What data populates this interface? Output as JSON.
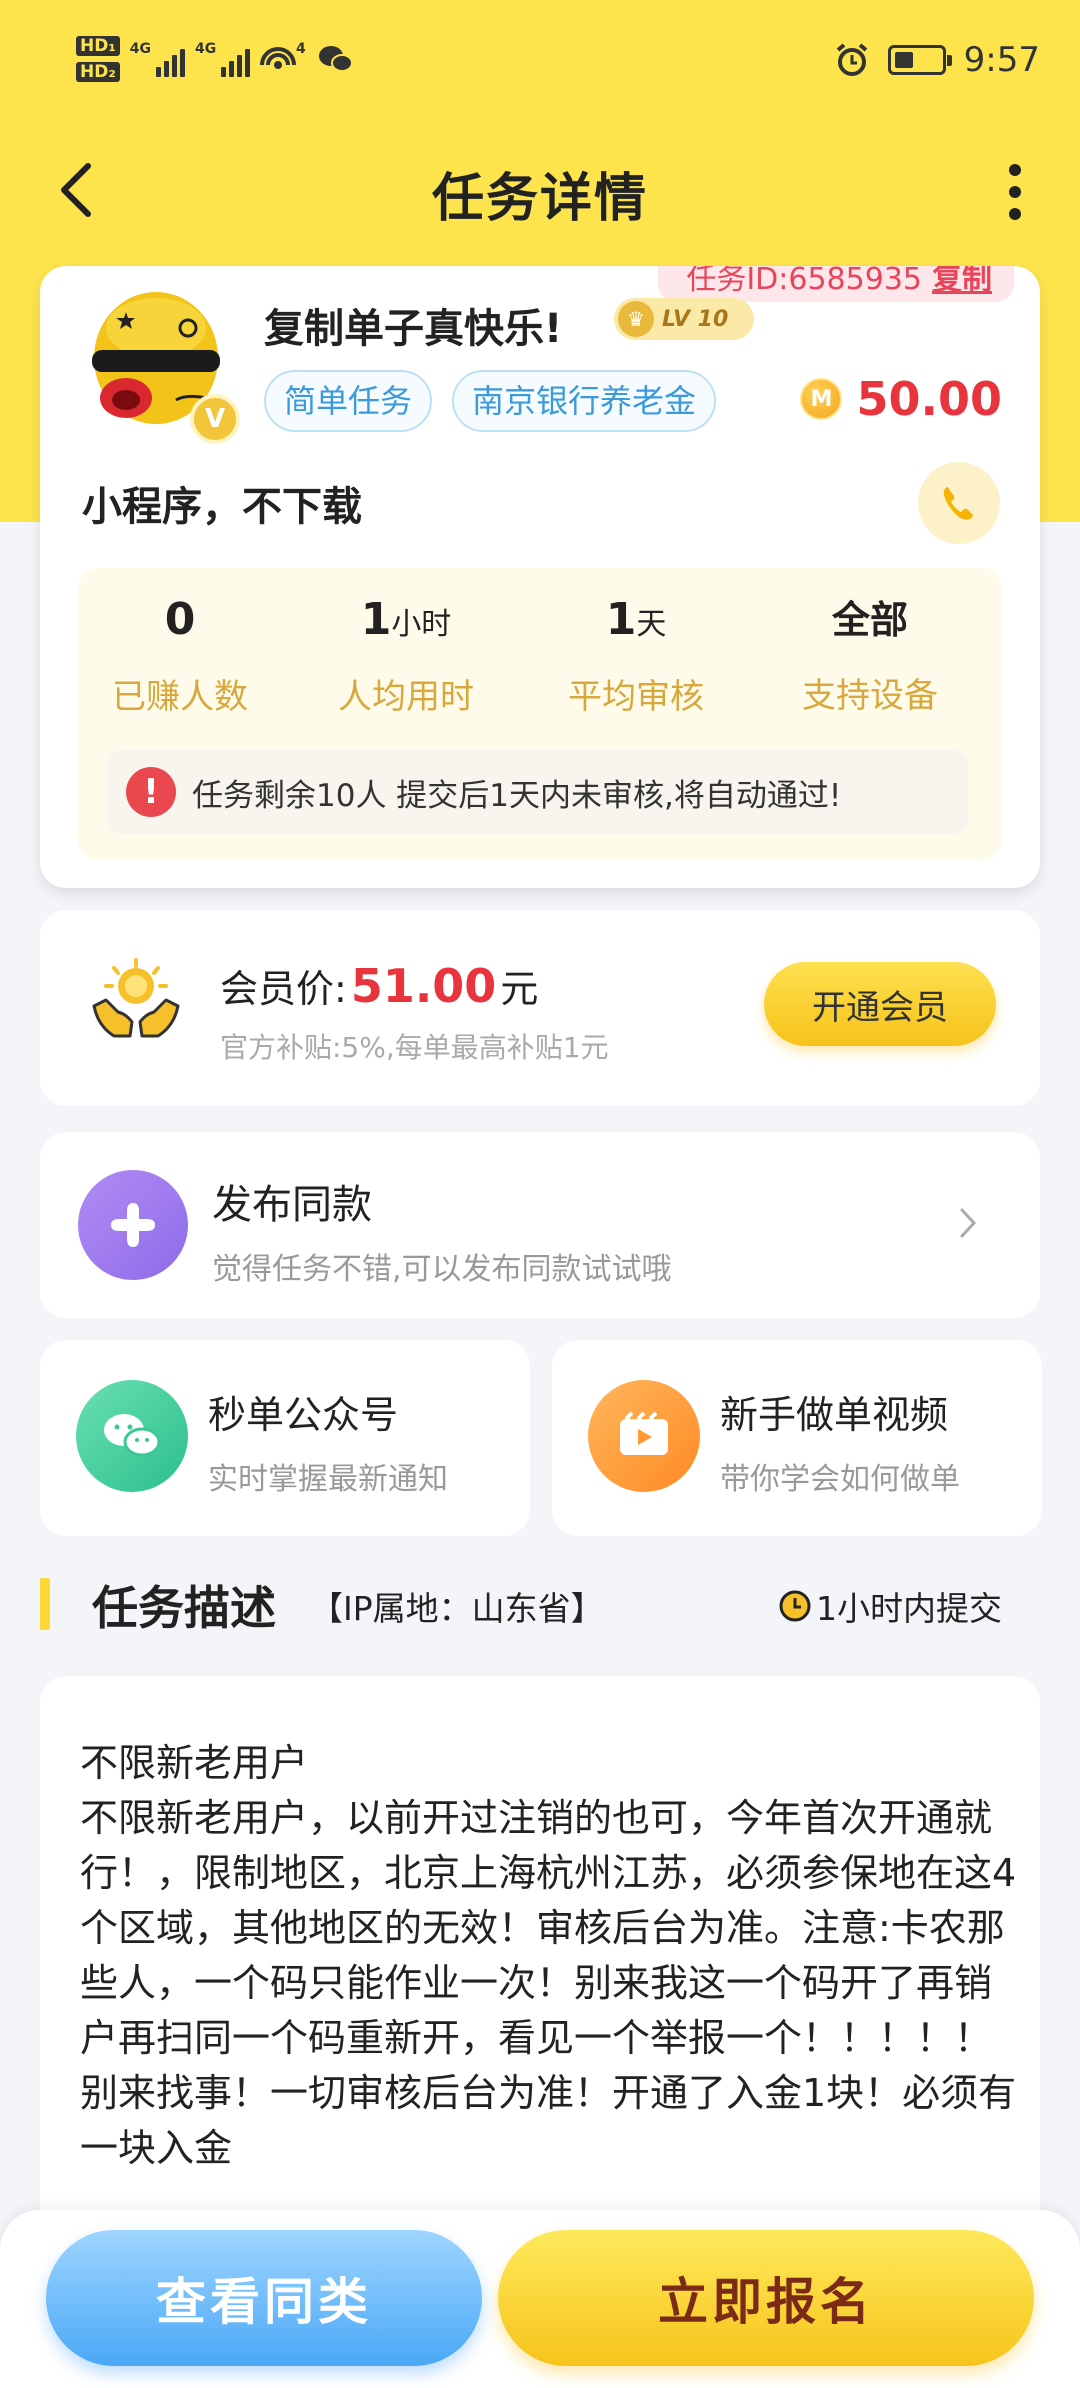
{
  "status_bar": {
    "hd1": "HD₁",
    "hd2": "HD₂",
    "net1": "4G",
    "net2": "4G",
    "wifi_badge": "4",
    "time": "9:57"
  },
  "nav": {
    "title": "任务详情"
  },
  "task": {
    "id_label": "任务ID:6585935",
    "copy_label": "复制",
    "title": "复制单子真快乐!",
    "level": "LV 10",
    "tags": [
      "简单任务",
      "南京银行养老金"
    ],
    "reward": "50.00",
    "subtitle": "小程序，不下载",
    "stats": [
      {
        "value": "0",
        "unit": "",
        "label": "已赚人数"
      },
      {
        "value": "1",
        "unit": "小时",
        "label": "人均用时"
      },
      {
        "value": "1",
        "unit": "天",
        "label": "平均审核"
      },
      {
        "value": "全部",
        "unit": "",
        "label": "支持设备"
      }
    ],
    "notice": "任务剩余10人  提交后1天内未审核,将自动通过!"
  },
  "member": {
    "price_prefix": "会员价:",
    "price_value": "51.00",
    "price_unit": "元",
    "subtitle": "官方补贴:5%,每单最高补贴1元",
    "button": "开通会员"
  },
  "publish": {
    "title": "发布同款",
    "subtitle": "觉得任务不错,可以发布同款试试哦"
  },
  "wechat": {
    "title": "秒单公众号",
    "subtitle": "实时掌握最新通知"
  },
  "video": {
    "title": "新手做单视频",
    "subtitle": "带你学会如何做单"
  },
  "section": {
    "title": "任务描述",
    "ip": "【IP属地：山东省】",
    "deadline": "1小时内提交"
  },
  "description": "不限新老用户\n不限新老用户，以前开过注销的也可，今年首次开通就行！，限制地区，北京上海杭州江苏，必须参保地在这4个区域，其他地区的无效！审核后台为准。注意:卡农那些人，一个码只能作业一次！别来我这一个码开了再销户再扫同一个码重新开，看见一个举报一个！！！！！别来找事！一切审核后台为准！开通了入金1块！必须有一块入金",
  "bottom": {
    "same_label": "查看同类",
    "signup_label": "立即报名"
  },
  "colors": {
    "header": "#fde44d",
    "accent_red": "#e8353d",
    "accent_blue": "#4aa8f6"
  }
}
